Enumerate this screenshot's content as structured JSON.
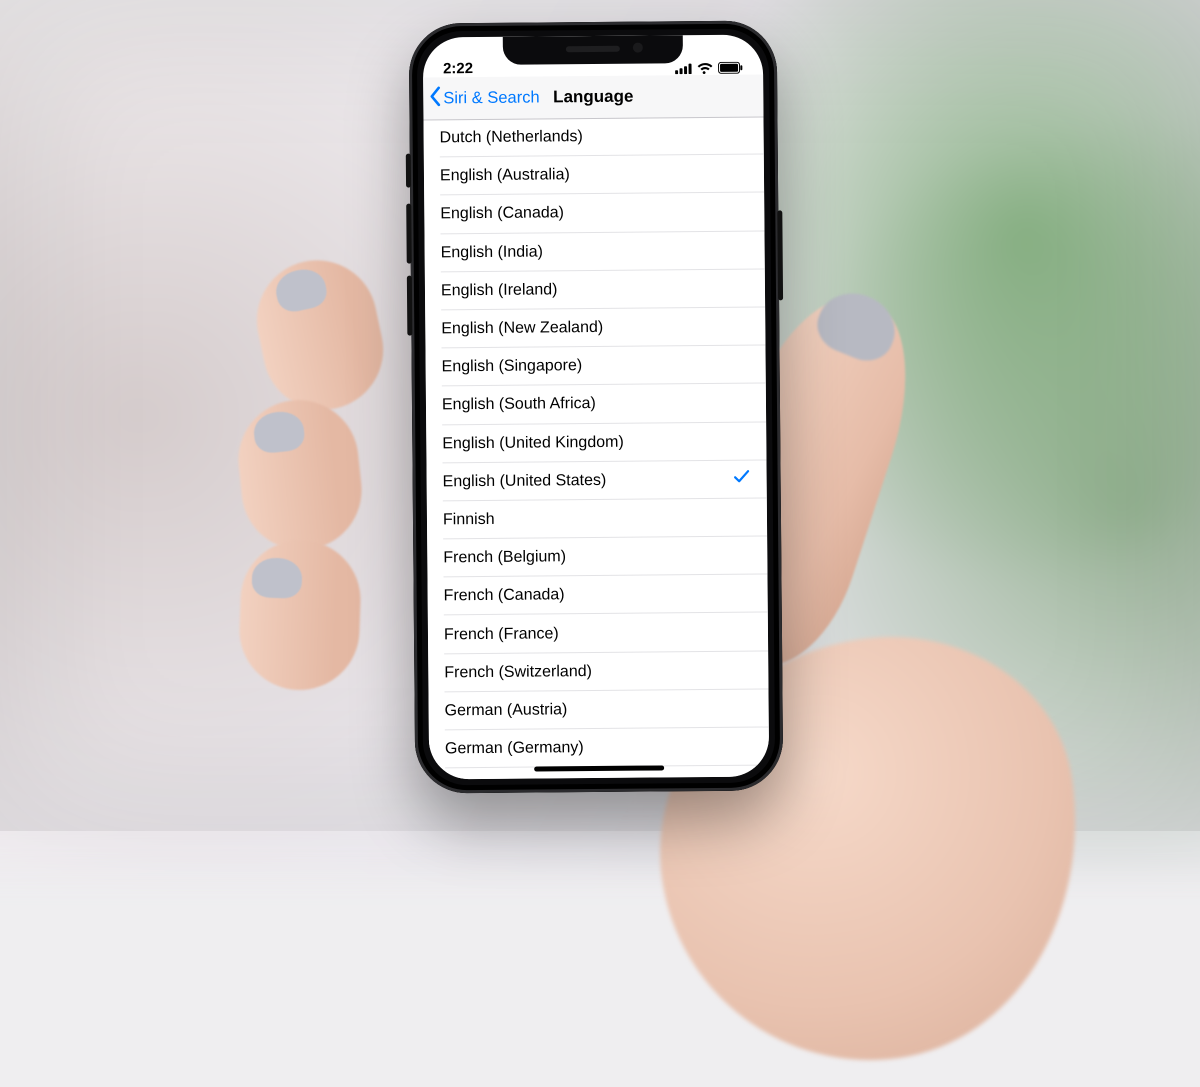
{
  "status": {
    "time": "2:22"
  },
  "nav": {
    "back_label": "Siri & Search",
    "title": "Language"
  },
  "languages": [
    {
      "label": "Dutch (Netherlands)",
      "selected": false
    },
    {
      "label": "English (Australia)",
      "selected": false
    },
    {
      "label": "English (Canada)",
      "selected": false
    },
    {
      "label": "English (India)",
      "selected": false
    },
    {
      "label": "English (Ireland)",
      "selected": false
    },
    {
      "label": "English (New Zealand)",
      "selected": false
    },
    {
      "label": "English (Singapore)",
      "selected": false
    },
    {
      "label": "English (South Africa)",
      "selected": false
    },
    {
      "label": "English (United Kingdom)",
      "selected": false
    },
    {
      "label": "English (United States)",
      "selected": true
    },
    {
      "label": "Finnish",
      "selected": false
    },
    {
      "label": "French (Belgium)",
      "selected": false
    },
    {
      "label": "French (Canada)",
      "selected": false
    },
    {
      "label": "French (France)",
      "selected": false
    },
    {
      "label": "French (Switzerland)",
      "selected": false
    },
    {
      "label": "German (Austria)",
      "selected": false
    },
    {
      "label": "German (Germany)",
      "selected": false
    }
  ]
}
